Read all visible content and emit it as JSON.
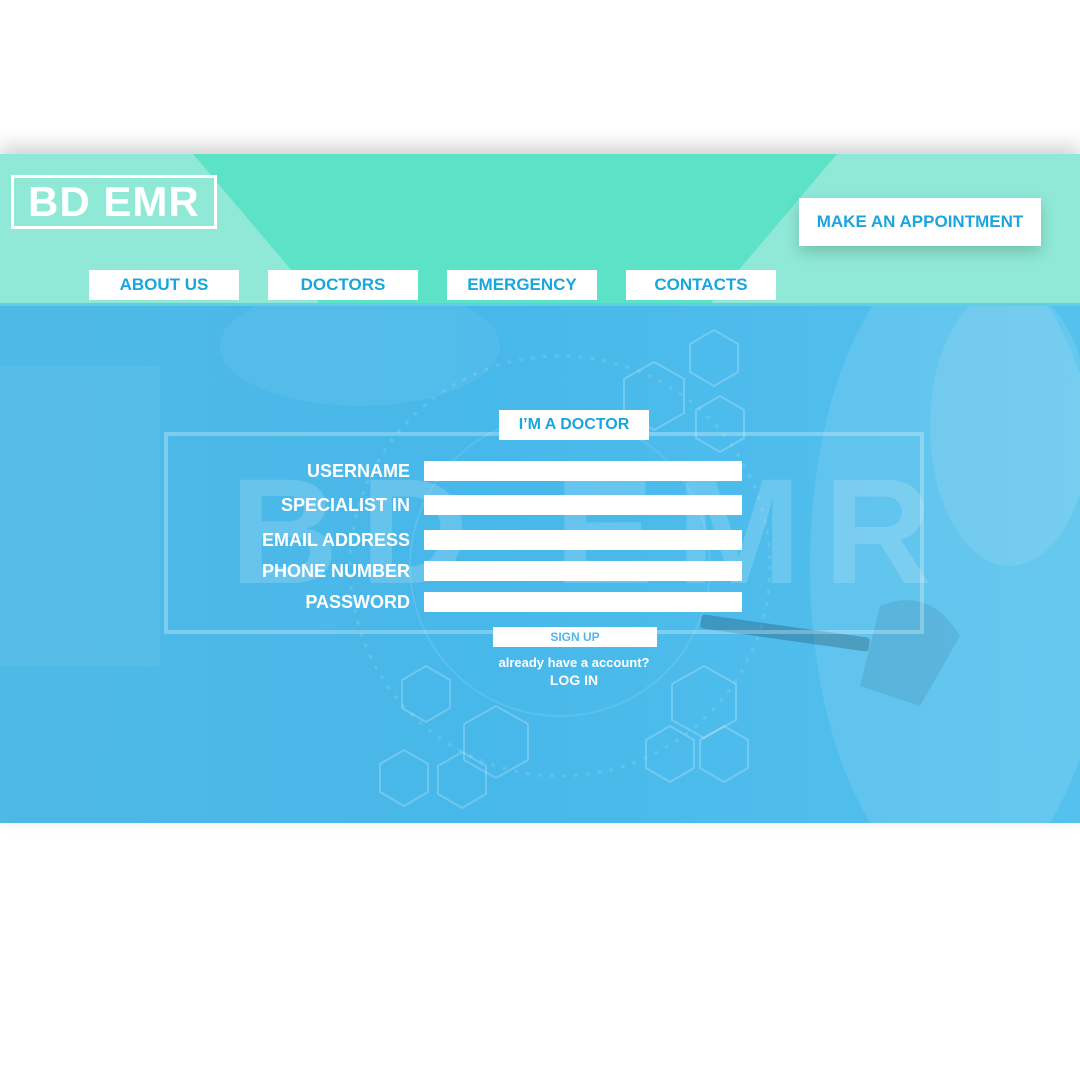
{
  "brand": {
    "logo": "BD EMR"
  },
  "header": {
    "appointment_label": "MAKE AN APPOINTMENT",
    "nav": [
      {
        "label": "ABOUT US"
      },
      {
        "label": "DOCTORS"
      },
      {
        "label": "EMERGENCY"
      },
      {
        "label": "CONTACTS"
      }
    ]
  },
  "form": {
    "role_tag": "I’M A DOCTOR",
    "watermark": "BD EMR",
    "fields": [
      {
        "label": "USERNAME",
        "value": ""
      },
      {
        "label": "SPECIALIST IN",
        "value": ""
      },
      {
        "label": "EMAIL ADDRESS",
        "value": ""
      },
      {
        "label": "PHONE NUMBER",
        "value": ""
      },
      {
        "label": "PASSWORD",
        "value": ""
      }
    ],
    "signup_label": "SIGN UP",
    "already_text": "already have a account?",
    "login_label": "LOG IN"
  },
  "colors": {
    "accent": "#1aa6dc",
    "header_light": "#8fe9d6",
    "header_dark": "#5ce3c7",
    "hero": "#4fb9e6"
  }
}
